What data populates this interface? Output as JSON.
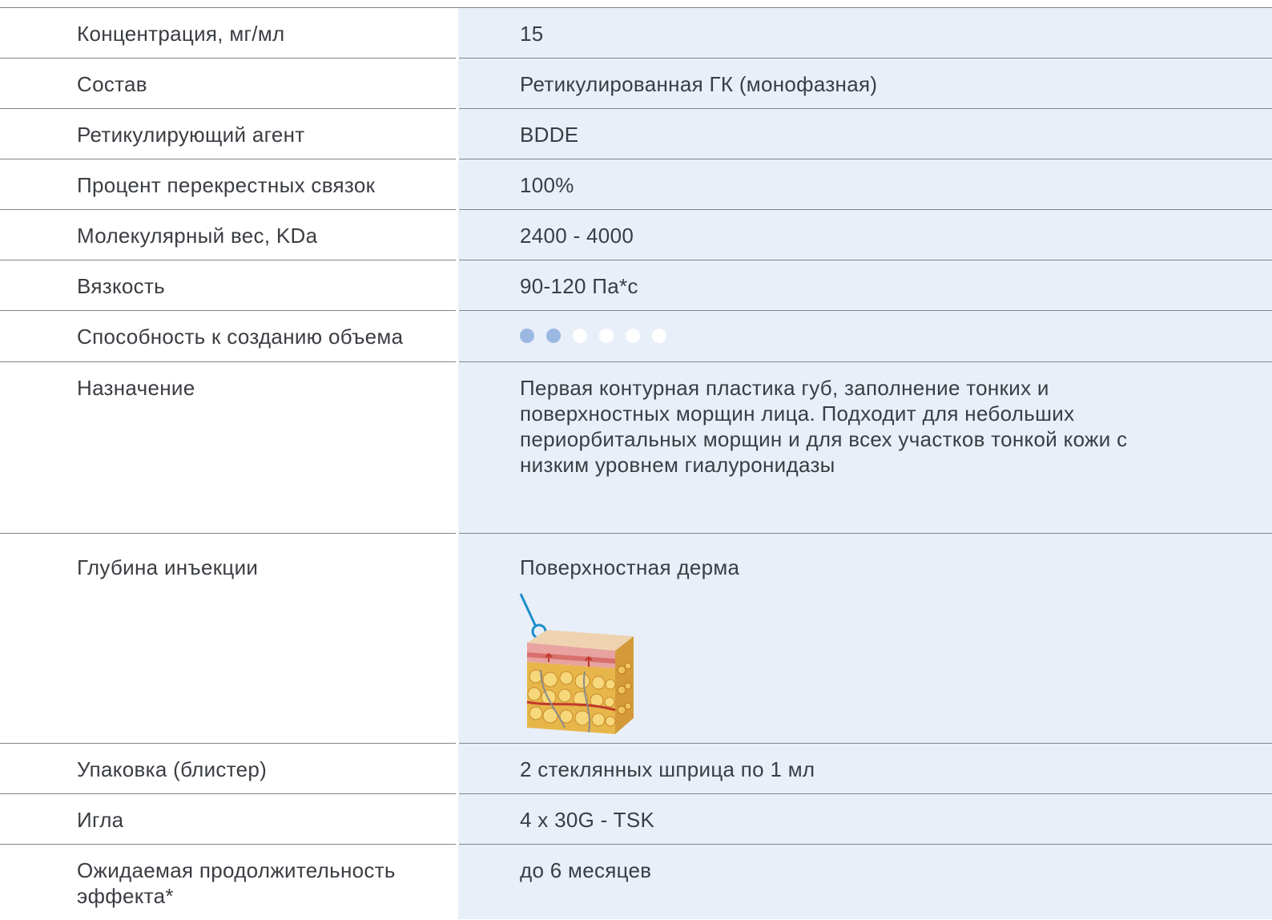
{
  "rows": [
    {
      "label": "Концентрация, мг/мл",
      "value": "15"
    },
    {
      "label": "Состав",
      "value": "Ретикулированная ГК (монофазная)"
    },
    {
      "label": "Ретикулирующий агент",
      "value": "BDDE"
    },
    {
      "label": "Процент перекрестных связок",
      "value": "100%"
    },
    {
      "label": "Молекулярный вес, KDa",
      "value": "2400 - 4000"
    },
    {
      "label": "Вязкость",
      "value": "90-120 Па*с"
    },
    {
      "label": "Способность к созданию объема",
      "rating": {
        "filled": 2,
        "total": 6
      }
    },
    {
      "label": "Назначение",
      "value": "Первая контурная пластика губ, заполнение тонких и поверхностных морщин лица. Подходит для небольших периорбитальных морщин и для всех участков тонкой кожи с низким уровнем гиалуронидазы"
    },
    {
      "label": "Глубина инъекции",
      "value": "Поверхностная дерма",
      "icon": "skin-layers-illustration"
    },
    {
      "label": "Упаковка (блистер)",
      "value": "2 стеклянных шприца по 1 мл"
    },
    {
      "label": "Игла",
      "value": "4 x 30G - TSK"
    },
    {
      "label": "Ожидаемая продолжительность эффекта*",
      "value": "до 6 месяцев"
    }
  ],
  "colors": {
    "value_column_bg": "#e8eff9",
    "rating_filled": "#9bb8e3",
    "rating_empty": "#ffffff",
    "divider": "#7f858c",
    "text": "#3a3d42"
  }
}
